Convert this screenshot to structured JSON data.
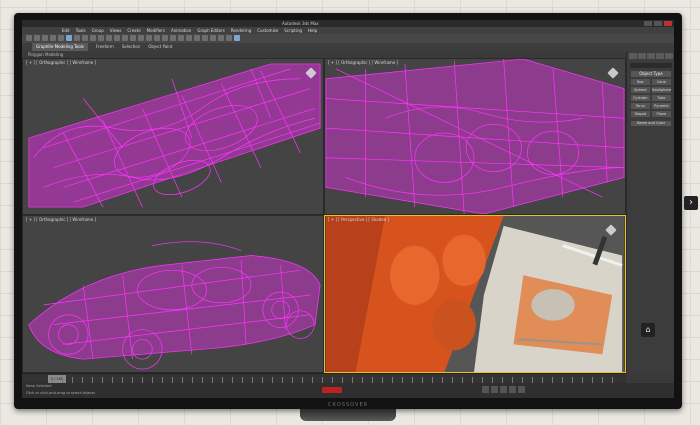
{
  "app": {
    "title": "Autodesk 3ds Max"
  },
  "menu": [
    "Edit",
    "Tools",
    "Group",
    "Views",
    "Create",
    "Modifiers",
    "Animation",
    "Graph Editors",
    "Rendering",
    "Customize",
    "Scripting",
    "Help"
  ],
  "ribbon": {
    "tabs": [
      "Graphite Modeling Tools",
      "Freeform",
      "Selection",
      "Object Paint"
    ],
    "active_index": 0
  },
  "ribbon_sub": "Polygon Modeling",
  "viewports": [
    {
      "label": "[ + ] [ Orthographic ] [ Wireframe ]"
    },
    {
      "label": "[ + ] [ Orthographic ] [ Wireframe ]"
    },
    {
      "label": "[ + ] [ Orthographic ] [ Wireframe ]"
    },
    {
      "label": "[ + ] [ Perspective ] [ Shaded ]"
    }
  ],
  "command_panel": {
    "section": "Object Type",
    "buttons": [
      "Box",
      "Cone",
      "Sphere",
      "GeoSphere",
      "Cylinder",
      "Tube",
      "Torus",
      "Pyramid",
      "Teapot",
      "Plane"
    ],
    "name_color": "Name and Color"
  },
  "timeline": {
    "position": "0 / 100"
  },
  "status": {
    "line1": "None Selected",
    "line2": "Click or click-and-drag to select objects"
  },
  "monitor": {
    "brand": "CROSSOVER"
  },
  "colors": {
    "wire": "#ff33ff",
    "viewport_bg": "#444444",
    "active_border": "#e6c21a",
    "shaded": "#e2581f"
  },
  "icons": {
    "next": "chevron-right-icon",
    "home": "home-icon",
    "viewcube": "viewcube-icon"
  }
}
